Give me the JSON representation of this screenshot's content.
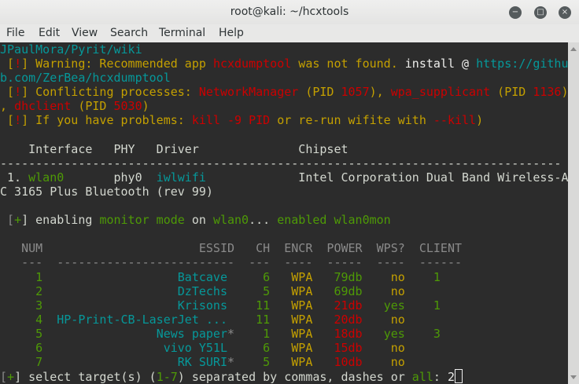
{
  "window": {
    "title": "root@kali: ~/hcxtools",
    "minimize": "−",
    "maximize": "□",
    "close": "×"
  },
  "menu": [
    "File",
    "Edit",
    "View",
    "Search",
    "Terminal",
    "Help"
  ],
  "colors": {
    "bg": "#2c2c2c",
    "fg": "#d3d7cf",
    "y": "#c4a000",
    "r": "#cc0000",
    "g": "#4e9a06",
    "c": "#06989a",
    "w": "#eeeeec",
    "d": "#8a8a8a"
  },
  "terminal": {
    "lines": [
      [
        {
          "t": "JPaulMora/Pyrit/wiki",
          "c": "c"
        }
      ],
      [
        {
          "t": " [",
          "c": "y"
        },
        {
          "t": "!",
          "c": "r"
        },
        {
          "t": "] Warning: Recommended app ",
          "c": "y"
        },
        {
          "t": "hcxdumptool",
          "c": "r"
        },
        {
          "t": " was not found. ",
          "c": "y"
        },
        {
          "t": "install @ ",
          "c": "w"
        },
        {
          "t": "https://githu",
          "c": "c"
        }
      ],
      [
        {
          "t": "b.com/ZerBea/hcxdumptool",
          "c": "c"
        }
      ],
      [
        {
          "t": " [",
          "c": "y"
        },
        {
          "t": "!",
          "c": "r"
        },
        {
          "t": "] Conflicting processes: ",
          "c": "y"
        },
        {
          "t": "NetworkManager",
          "c": "r"
        },
        {
          "t": " (PID ",
          "c": "y"
        },
        {
          "t": "1057",
          "c": "r"
        },
        {
          "t": "), ",
          "c": "y"
        },
        {
          "t": "wpa_supplicant",
          "c": "r"
        },
        {
          "t": " (PID ",
          "c": "y"
        },
        {
          "t": "1136",
          "c": "r"
        },
        {
          "t": ")",
          "c": "y"
        }
      ],
      [
        {
          "t": ", ",
          "c": "y"
        },
        {
          "t": "dhclient",
          "c": "r"
        },
        {
          "t": " (PID ",
          "c": "y"
        },
        {
          "t": "5030",
          "c": "r"
        },
        {
          "t": ")",
          "c": "y"
        }
      ],
      [
        {
          "t": " [",
          "c": "y"
        },
        {
          "t": "!",
          "c": "r"
        },
        {
          "t": "] If you have problems: ",
          "c": "y"
        },
        {
          "t": "kill -9 PID",
          "c": "r"
        },
        {
          "t": " or re-run wifite with ",
          "c": "y"
        },
        {
          "t": "--kill",
          "c": "r"
        },
        {
          "t": ")",
          "c": "y"
        }
      ],
      [],
      [
        {
          "t": "    Interface   PHY   Driver              Chipset",
          "c": "fg"
        }
      ],
      [
        {
          "t": "-------------------------------------------------------------------------------",
          "c": "fg"
        }
      ],
      [
        {
          "t": " 1. ",
          "c": "fg"
        },
        {
          "t": "wlan0",
          "c": "g"
        },
        {
          "t": "       phy0  ",
          "c": "fg"
        },
        {
          "t": "iwlwifi",
          "c": "c"
        },
        {
          "t": "             Intel Corporation Dual Band Wireless-A",
          "c": "fg"
        }
      ],
      [
        {
          "t": "C 3165 Plus Bluetooth (rev 99)",
          "c": "fg"
        }
      ],
      [],
      [
        {
          "t": " [",
          "c": "d"
        },
        {
          "t": "+",
          "c": "g"
        },
        {
          "t": "] enabling ",
          "c": "fg"
        },
        {
          "t": "monitor mode",
          "c": "g"
        },
        {
          "t": " on ",
          "c": "fg"
        },
        {
          "t": "wlan0",
          "c": "g"
        },
        {
          "t": "... ",
          "c": "fg"
        },
        {
          "t": "enabled wlan0mon",
          "c": "g"
        }
      ],
      [],
      [
        {
          "t": "   NUM                      ESSID   CH  ENCR  POWER  WPS?  CLIENT",
          "c": "d"
        }
      ],
      [
        {
          "t": "   ---  -------------------------  ---  ----  -----  ----  ------",
          "c": "d"
        }
      ]
    ],
    "networks": [
      {
        "num": "1",
        "essid": "Batcave",
        "hidden": false,
        "ch": "6",
        "encr": "WPA",
        "power": "79db",
        "strong": true,
        "wps": "no",
        "client": "1"
      },
      {
        "num": "2",
        "essid": "DzTechs",
        "hidden": false,
        "ch": "5",
        "encr": "WPA",
        "power": "69db",
        "strong": true,
        "wps": "no",
        "client": ""
      },
      {
        "num": "3",
        "essid": "Krisons",
        "hidden": false,
        "ch": "11",
        "encr": "WPA",
        "power": "21db",
        "strong": false,
        "wps": "yes",
        "client": "1"
      },
      {
        "num": "4",
        "essid": "HP-Print-CB-LaserJet ...",
        "hidden": false,
        "ch": "11",
        "encr": "WPA",
        "power": "20db",
        "strong": false,
        "wps": "no",
        "client": ""
      },
      {
        "num": "5",
        "essid": "News paper",
        "hidden": true,
        "ch": "1",
        "encr": "WPA",
        "power": "18db",
        "strong": false,
        "wps": "yes",
        "client": "3"
      },
      {
        "num": "6",
        "essid": "vivo Y51L",
        "hidden": false,
        "ch": "6",
        "encr": "WPA",
        "power": "15db",
        "strong": false,
        "wps": "no",
        "client": ""
      },
      {
        "num": "7",
        "essid": "RK SURI",
        "hidden": true,
        "ch": "5",
        "encr": "WPA",
        "power": "10db",
        "strong": false,
        "wps": "no",
        "client": ""
      }
    ],
    "hidden_marker": "*",
    "prompt": [
      {
        "t": "[",
        "c": "d"
      },
      {
        "t": "+",
        "c": "g"
      },
      {
        "t": "] select target(s) (",
        "c": "fg"
      },
      {
        "t": "1-7",
        "c": "g"
      },
      {
        "t": ") separated by commas, dashes or ",
        "c": "fg"
      },
      {
        "t": "all",
        "c": "g"
      },
      {
        "t": ": ",
        "c": "fg"
      }
    ],
    "input_value": "2"
  }
}
